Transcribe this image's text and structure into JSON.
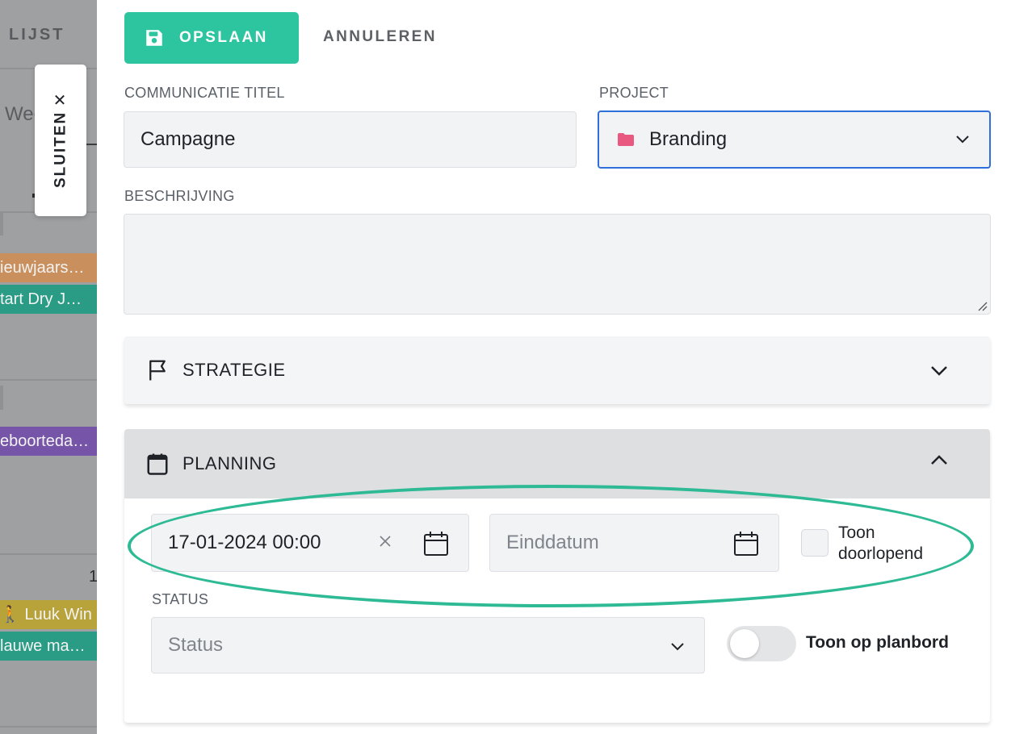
{
  "background": {
    "tab_label": "LIJST",
    "view_label": "Wee",
    "events": [
      {
        "label": "ieuwjaars…",
        "color": "#c98f5c"
      },
      {
        "label": "tart Dry J…",
        "color": "#2a9c85"
      },
      {
        "label": "eboorteda…",
        "color": "#7655a9"
      },
      {
        "label": "🚶 Luuk Win",
        "color": "#b8a23a"
      },
      {
        "label": "lauwe ma…",
        "color": "#2a9c85"
      }
    ],
    "day_number": "1"
  },
  "close_tab": {
    "label": "SLUITEN",
    "icon": "close-icon"
  },
  "toolbar": {
    "save_label": "OPSLAAN",
    "save_icon": "save-icon",
    "cancel_label": "ANNULEREN",
    "accent_color": "#2dc59f"
  },
  "form": {
    "title_label": "COMMUNICATIE TITEL",
    "title_value": "Campagne",
    "project_label": "PROJECT",
    "project_value": "Branding",
    "project_icon": "folder-icon",
    "project_icon_color": "#e8587f",
    "description_label": "BESCHRIJVING",
    "description_value": ""
  },
  "sections": {
    "strategie": {
      "label": "STRATEGIE",
      "icon": "flag-icon",
      "state": "collapsed"
    },
    "planning": {
      "label": "PLANNING",
      "icon": "calendar-icon",
      "state": "expanded",
      "start_date": "17-01-2024 00:00",
      "end_placeholder": "Einddatum",
      "checkbox_label_line1": "Toon",
      "checkbox_label_line2": "doorlopend",
      "checkbox_checked": false,
      "status_label": "STATUS",
      "status_placeholder": "Status",
      "toggle_label": "Toon op planbord",
      "toggle_on": false
    }
  },
  "annotation": {
    "shape": "ellipse",
    "color": "#2dba94"
  }
}
